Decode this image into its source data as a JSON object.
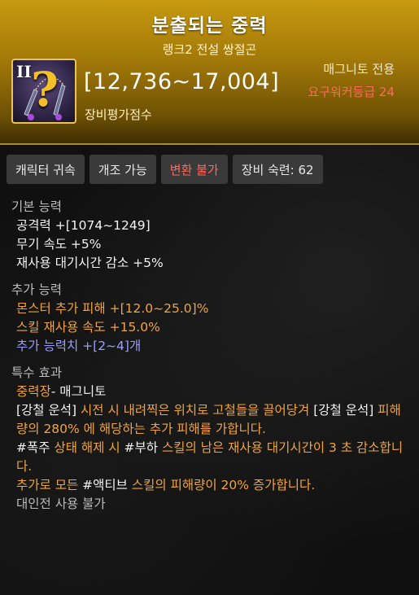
{
  "header": {
    "title": "분출되는 중력",
    "subtitle": "랭크2 전설 쌍절곤",
    "rank_badge": "II",
    "icon_glyph": "?",
    "score": "[12,736~17,004]",
    "score_label": "장비평가점수",
    "job": "매그니토 전용",
    "requirement": "요구워커등급 24",
    "accent_color": "#c79a10",
    "requirement_color": "#ff6b5a"
  },
  "tags": [
    {
      "label": "캐릭터 귀속"
    },
    {
      "label": "개조 가능"
    },
    {
      "label": "변환 불가"
    },
    {
      "label": "장비 숙련: 62"
    }
  ],
  "basic": {
    "title": "기본 능력",
    "lines": [
      "공격력  +[1074~1249]",
      "무기 속도 +5%",
      "재사용 대기시간 감소 +5%"
    ]
  },
  "extra": {
    "title": "추가 능력",
    "lines": [
      "몬스터 추가 피해  +[12.0~25.0]%",
      "스킬 재사용 속도  +15.0%",
      "추가 능력치 +[2~4]개"
    ]
  },
  "special": {
    "title": "특수 효과",
    "name": "중력장",
    "name_suffix": "- 매그니토",
    "desc1_a": "[강철 운석] ",
    "desc1_b": "시전 시 내려찍은 위치로 고철들을 끌어당겨 ",
    "desc1_c": "[강철 운석] ",
    "desc1_d": "피해량의 280% 에 해당하는 추가 피해를 가합니다.",
    "desc2_a": "#폭주 ",
    "desc2_b": "상태 해제 시 ",
    "desc2_c": "#부하 ",
    "desc2_d": "스킬의 남은 재사용 대기시간이 3 초 감소합니다.",
    "desc3_a": "추가로 모든 ",
    "desc3_b": "#액티브 ",
    "desc3_c": "스킬의 피해량이 20% 증가합니다.",
    "pvp": "대인전 사용 불가"
  }
}
